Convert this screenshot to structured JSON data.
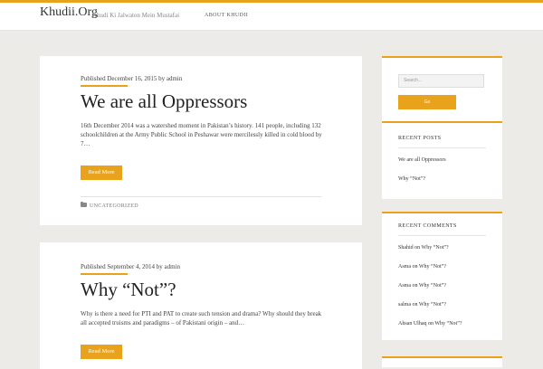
{
  "header": {
    "site_title": "Khudii.Org",
    "tagline": "Khudi Ki Jalwaton Mein Mustafai",
    "nav": [
      "ABOUT KHUDII"
    ]
  },
  "posts": [
    {
      "meta": "Published December 16, 2015 by admin",
      "title": "We are all Oppressors",
      "excerpt": "16th December 2014 was a watershed moment in Pakistan’s history. 141 people, including 132 schoolchildren at the Army Public School in Peshawar were mercilessly killed in cold blood by 7…",
      "button": "Read More",
      "category": "UNCATEGORIZED"
    },
    {
      "meta": "Published September 4, 2014 by admin",
      "title": "Why “Not”?",
      "excerpt": "Why is there a need for PTI and PAT to create such tension and drama? Why should they break all accepted truisms and paradigms – of Pakistani origin – and…",
      "button": "Read More"
    }
  ],
  "sidebar": {
    "search": {
      "placeholder": "Search...",
      "button": "Go"
    },
    "recent_posts": {
      "title": "RECENT POSTS",
      "items": [
        "We are all Oppressors",
        "Why “Not”?"
      ]
    },
    "recent_comments": {
      "title": "RECENT COMMENTS",
      "items": [
        "Shahid on Why “Not”?",
        "Asma on Why “Not”?",
        "Asma on Why “Not”?",
        "salma on Why “Not”?",
        "Ahsan Ulhaq on Why “Not”?"
      ]
    }
  },
  "colors": {
    "accent": "#e8a21c",
    "background": "#ecebe8",
    "card": "#ffffff"
  }
}
